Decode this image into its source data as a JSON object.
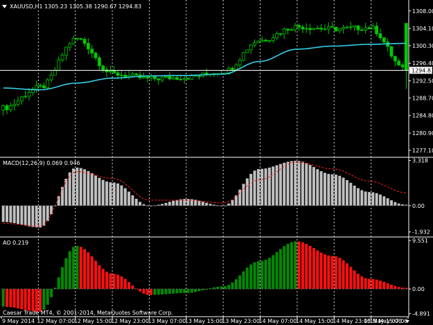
{
  "window": {
    "symbol_title": "XAUUSD,H1  1305.23 1305.38 1290.67 1294.83",
    "bid_label": "1294.83",
    "copyright": "Caesar Trade MT4, © 2001-2014, MetaQuotes Software Corp."
  },
  "price_panel": {
    "yticks": [
      "1308.00",
      "1304.10",
      "1300.30",
      "1296.40",
      "1292.50",
      "1288.70",
      "1284.80",
      "1280.90",
      "1277.10"
    ],
    "ylim": [
      1276.0,
      1309.5
    ],
    "ma_color": "#36d0e8",
    "bid_level": 1294.83,
    "bid_line_color": "#ffffff",
    "candle_color": "#00c800"
  },
  "macd_panel": {
    "label": "MACD(12,26,9) 0.069 0.946",
    "yticks": [
      "3.318",
      "0.00",
      "-1.932"
    ],
    "ylim": [
      -2.2,
      3.4
    ],
    "histogram_color": "#c0c0c0",
    "signal_color": "#ff2020"
  },
  "ao_panel": {
    "label": "AO 0.219",
    "yticks": [
      "9.551",
      "0.00",
      "-4.891"
    ],
    "ylim": [
      -5.2,
      9.7
    ],
    "up_color": "#008c00",
    "down_color": "#ff1010"
  },
  "time_axis": {
    "labels": [
      "9 May 2014",
      "12 May 07:00",
      "12 May 15:00",
      "12 May 23:00",
      "13 May 07:00",
      "13 May 15:00",
      "13 May 23:00",
      "14 May 07:00",
      "14 May 15:00",
      "14 May 23:00",
      "15 May 07:00",
      "15 May 15:00"
    ],
    "separator_color": "#ffffff"
  },
  "chart_data": {
    "type": "candlestick",
    "x": [
      "9 May 2014",
      "12 May 07:00",
      "12 May 15:00",
      "12 May 23:00",
      "13 May 07:00",
      "13 May 15:00",
      "13 May 23:00",
      "14 May 07:00",
      "14 May 15:00",
      "14 May 23:00",
      "15 May 07:00",
      "15 May 15:00"
    ],
    "price_anchors": [
      1286.5,
      1291.0,
      1301.8,
      1294.0,
      1293.0,
      1293.3,
      1294.5,
      1301.5,
      1304.5,
      1304.0,
      1304.3,
      1294.83
    ],
    "ma_anchors": [
      1290.9,
      1290.5,
      1292.0,
      1293.1,
      1293.6,
      1293.7,
      1294.0,
      1296.8,
      1299.5,
      1300.2,
      1300.6,
      1300.8
    ],
    "macd_anchors": [
      -1.2,
      -1.6,
      2.8,
      1.7,
      0.0,
      0.5,
      0.0,
      2.7,
      3.3,
      2.3,
      1.0,
      0.069
    ],
    "signal_anchors": [
      -1.3,
      -1.5,
      2.5,
      2.0,
      0.4,
      0.4,
      0.2,
      1.9,
      3.2,
      2.7,
      1.8,
      0.946
    ],
    "ao_anchors": [
      -3.5,
      -4.5,
      8.5,
      3.0,
      -1.2,
      -0.8,
      0.5,
      5.5,
      9.4,
      6.5,
      2.0,
      0.219
    ],
    "last": {
      "open": 1305.23,
      "high": 1305.38,
      "low": 1290.67,
      "close": 1294.83
    }
  }
}
